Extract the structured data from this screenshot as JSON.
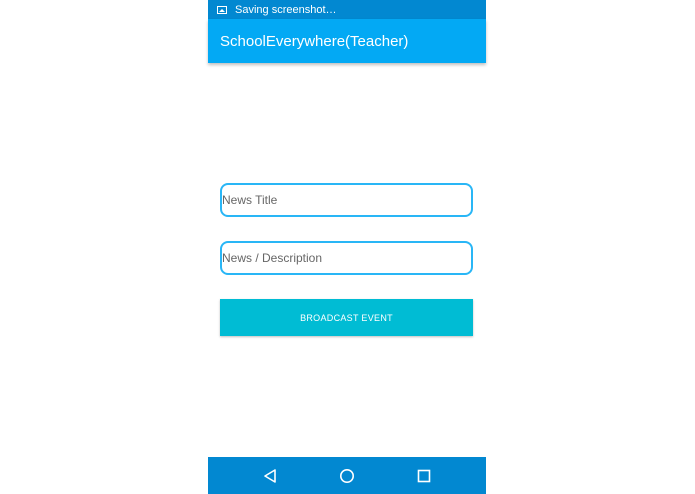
{
  "status_bar": {
    "notification_text": "Saving screenshot…",
    "notification_icon": "image-icon"
  },
  "app_bar": {
    "title": "SchoolEverywhere(Teacher)"
  },
  "form": {
    "title_field": {
      "value": "",
      "placeholder": "News Title"
    },
    "description_field": {
      "value": "",
      "placeholder": "News / Description"
    },
    "broadcast_button_label": "BROADCAST EVENT"
  },
  "nav_bar": {
    "icons": [
      "back-icon",
      "home-icon",
      "recents-icon"
    ]
  },
  "colors": {
    "status_bar": "#0288d1",
    "app_bar": "#03a9f4",
    "field_border": "#29b6f6",
    "button": "#00bcd4",
    "nav_bar": "#0288d1"
  }
}
